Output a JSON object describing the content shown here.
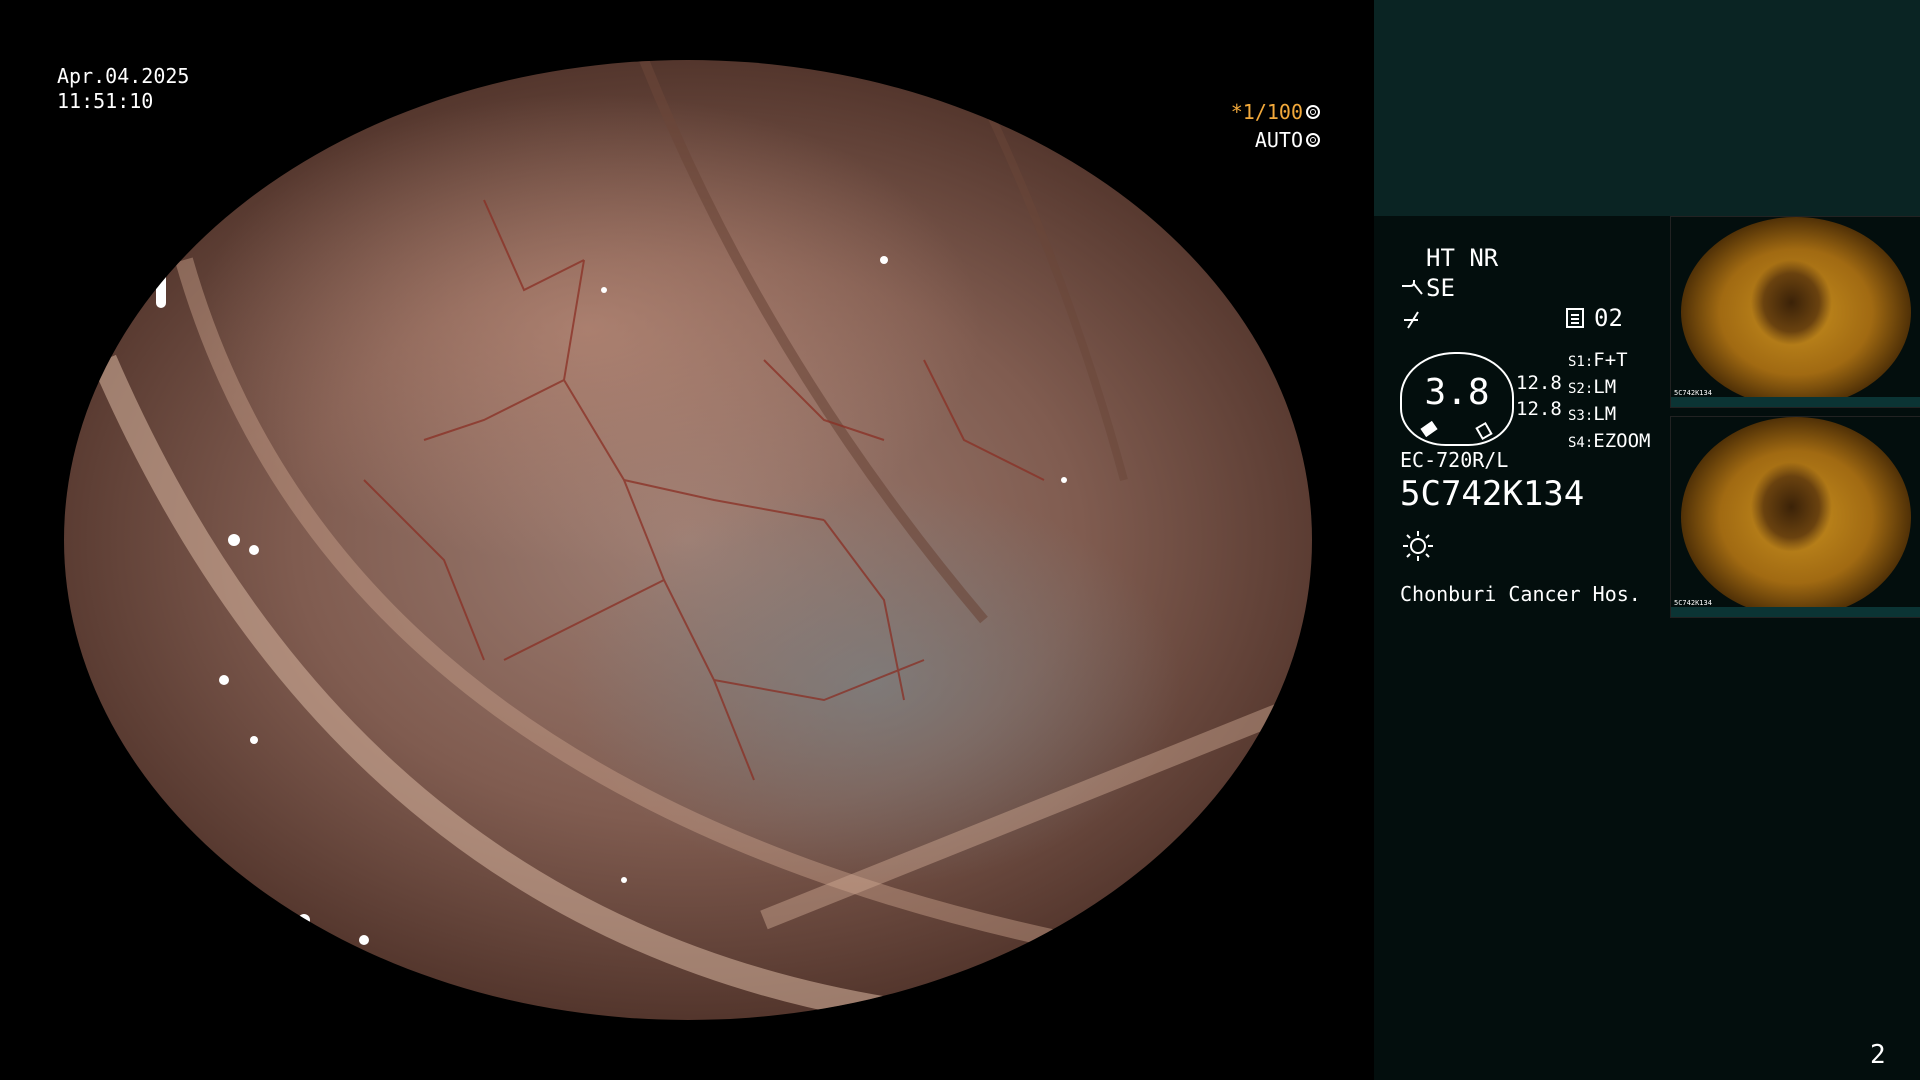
{
  "overlay": {
    "date": "Apr.04.2025",
    "time": "11:51:10",
    "shutter_speed": "*1/100",
    "iris_mode": "AUTO"
  },
  "settings": {
    "ht_nr": "HT NR",
    "enhance": "SE",
    "scope_model": "EC-720R/L",
    "serial_number": "5C742K134",
    "hospital": "Chonburi Cancer Hos.",
    "record_channel": "02",
    "gauge_value": "3.8",
    "gauge_side_top": "12.8",
    "gauge_side_bottom": "12.8",
    "switches": [
      {
        "key": "S1:",
        "value": "F+T"
      },
      {
        "key": "S2:",
        "value": "LM"
      },
      {
        "key": "S3:",
        "value": "LM"
      },
      {
        "key": "S4:",
        "value": "EZOOM"
      }
    ]
  },
  "thumbnails": [
    {
      "serial": "5C742K134"
    },
    {
      "serial": "5C742K134"
    }
  ],
  "page_number": "2",
  "colors": {
    "accent_orange": "#f2a93b",
    "panel_top": "#0a2423",
    "panel_bottom": "#030e0d"
  },
  "icons": [
    "iris-ring-icon",
    "auto-ring-icon",
    "enhance-curve-icon",
    "structure-icon",
    "record-doc-icon",
    "light-sun-icon"
  ]
}
